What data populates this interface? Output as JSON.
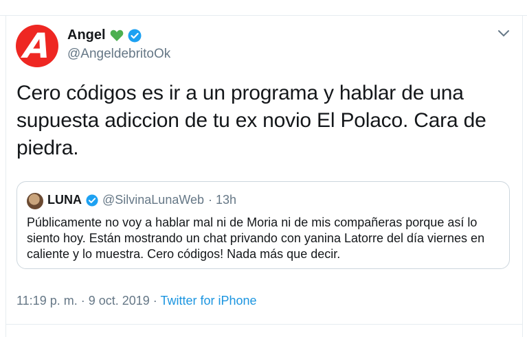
{
  "tweet": {
    "avatar_letter": "A",
    "display_name": "Angel",
    "handle": "@AngeldebritoOk",
    "text": "Cero códigos es ir a un programa y hablar de una supuesta adiccion de tu ex novio El Polaco. Cara de piedra.",
    "timestamp": "11:19 p. m. · 9 oct. 2019 · ",
    "source": "Twitter for iPhone"
  },
  "quoted": {
    "display_name": "LUNA",
    "handle": "@SilvinaLunaWeb",
    "age": "· 13h",
    "text": "Públicamente no voy a hablar mal ni de Moria ni de mis compañeras porque así lo siento hoy. Están mostrando un chat privando con yanina Latorre del día viernes en caliente y lo muestra. Cero códigos! Nada más que decir."
  },
  "colors": {
    "brand_red": "#ee2722",
    "verified_blue": "#1da1f2",
    "link_blue": "#1b95e0",
    "heart_green": "#4caf50",
    "muted_gray": "#657786"
  },
  "icons": [
    "green-heart-icon",
    "verified-badge-icon",
    "chevron-down-icon"
  ]
}
